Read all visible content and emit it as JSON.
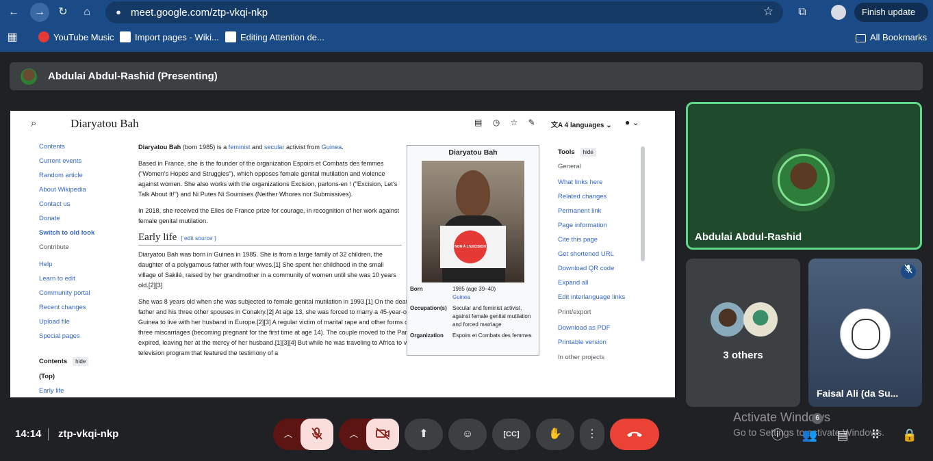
{
  "browser": {
    "url": "meet.google.com/ztp-vkqi-nkp",
    "finish_update": "Finish update",
    "bookmarks": [
      "YouTube Music",
      "Import pages - Wiki...",
      "Editing Attention de..."
    ],
    "all_bookmarks": "All Bookmarks"
  },
  "presenting_bar": {
    "label": "Abdulai Abdul-Rashid (Presenting)"
  },
  "wiki": {
    "title": "Diaryatou Bah",
    "languages": "4 languages",
    "nav": [
      "Contents",
      "Current events",
      "Random article",
      "About Wikipedia",
      "Contact us",
      "Donate",
      "Switch to old look"
    ],
    "contribute_heading": "Contribute",
    "contribute": [
      "Help",
      "Learn to edit",
      "Community portal",
      "Recent changes",
      "Upload file",
      "Special pages"
    ],
    "contents_heading": "Contents",
    "hide": "hide",
    "contents_items": [
      "(Top)",
      "Early life"
    ],
    "para1": {
      "name": "Diaryatou Bah",
      "born": " (born 1985) is a ",
      "l1": "feminist",
      "and": " and ",
      "l2": "secular",
      "rest": " activist from ",
      "l3": "Guinea",
      "end": "."
    },
    "para2": "Based in France, she is the founder of the organization Espoirs et Combats des femmes (\"Women's Hopes and Struggles\"), which opposes female genital mutilation and violence against women. She also works with the organizations Excision, parlons-en ! (\"Excision, Let's Talk About It!\") and Ni Putes Ni Soumises (Neither Whores nor Submissives).",
    "para3": "In 2018, she received the Elles de France prize for courage, in recognition of her work against female genital mutilation.",
    "h2": "Early life",
    "edit_source": "[ edit source ]",
    "para4": "Diaryatou Bah was born in Guinea in 1985. She is from a large family of 32 children, the daughter of a polygamous father with four wives.[1] She spent her childhood in the small village of Sakilé, raised by her grandmother in a community of women until she was 10 years old.[2][3]",
    "para5": "She was 8 years old when she was subjected to female genital mutilation in 1993.[1] On the death of her grandmother, Bah rejoined her father and his three other spouses in Conakry.[2] At age 13, she was forced to marry a 45-year-old man living in Amsterdam, so she left Guinea to live with her husband in Europe.[2][3] A regular victim of marital rape and other forms of intimate partner violence, she had three miscarriages (becoming pregnant for the first time at age 14). The couple moved to the Paris region in 2003, and her tourist visa expired, leaving her at the mercy of her husband.[1][3][4] But while he was traveling to Africa to visit another of his wives, she watched a television program that featured the testimony of a",
    "infobox": {
      "title": "Diaryatou Bah",
      "sign_text": "NON À L'EXCISION",
      "born_k": "Born",
      "born_v": "1985 (age 39–40)",
      "born_place": "Guinea",
      "occ_k": "Occupation(s)",
      "occ_v": "Secular and feminist activist, against female genital mutilation and forced marriage",
      "org_k": "Organization",
      "org_v": "Espoirs et Combats des femmes"
    },
    "tools_heading": "Tools",
    "general": "General",
    "tools": [
      "What links here",
      "Related changes",
      "Permanent link",
      "Page information",
      "Cite this page",
      "Get shortened URL",
      "Download QR code",
      "Expand all",
      "Edit interlanguage links"
    ],
    "print_heading": "Print/export",
    "print": [
      "Download as PDF",
      "Printable version"
    ],
    "other_heading": "In other projects"
  },
  "tiles": {
    "main": "Abdulai Abdul-Rashid",
    "others": "3 others",
    "faisal": "Faisal Ali (da Su..."
  },
  "footer": {
    "time": "14:14",
    "meeting_code": "ztp-vkqi-nkp",
    "participants_count": "6"
  },
  "watermark": {
    "line1": "Activate Windows",
    "line2": "Go to Settings to activate Windows."
  },
  "colors": {
    "chrome": "#1a4b86",
    "end_call": "#ea4335",
    "active_speaker": "#5fd88a",
    "link": "#3366cc"
  }
}
